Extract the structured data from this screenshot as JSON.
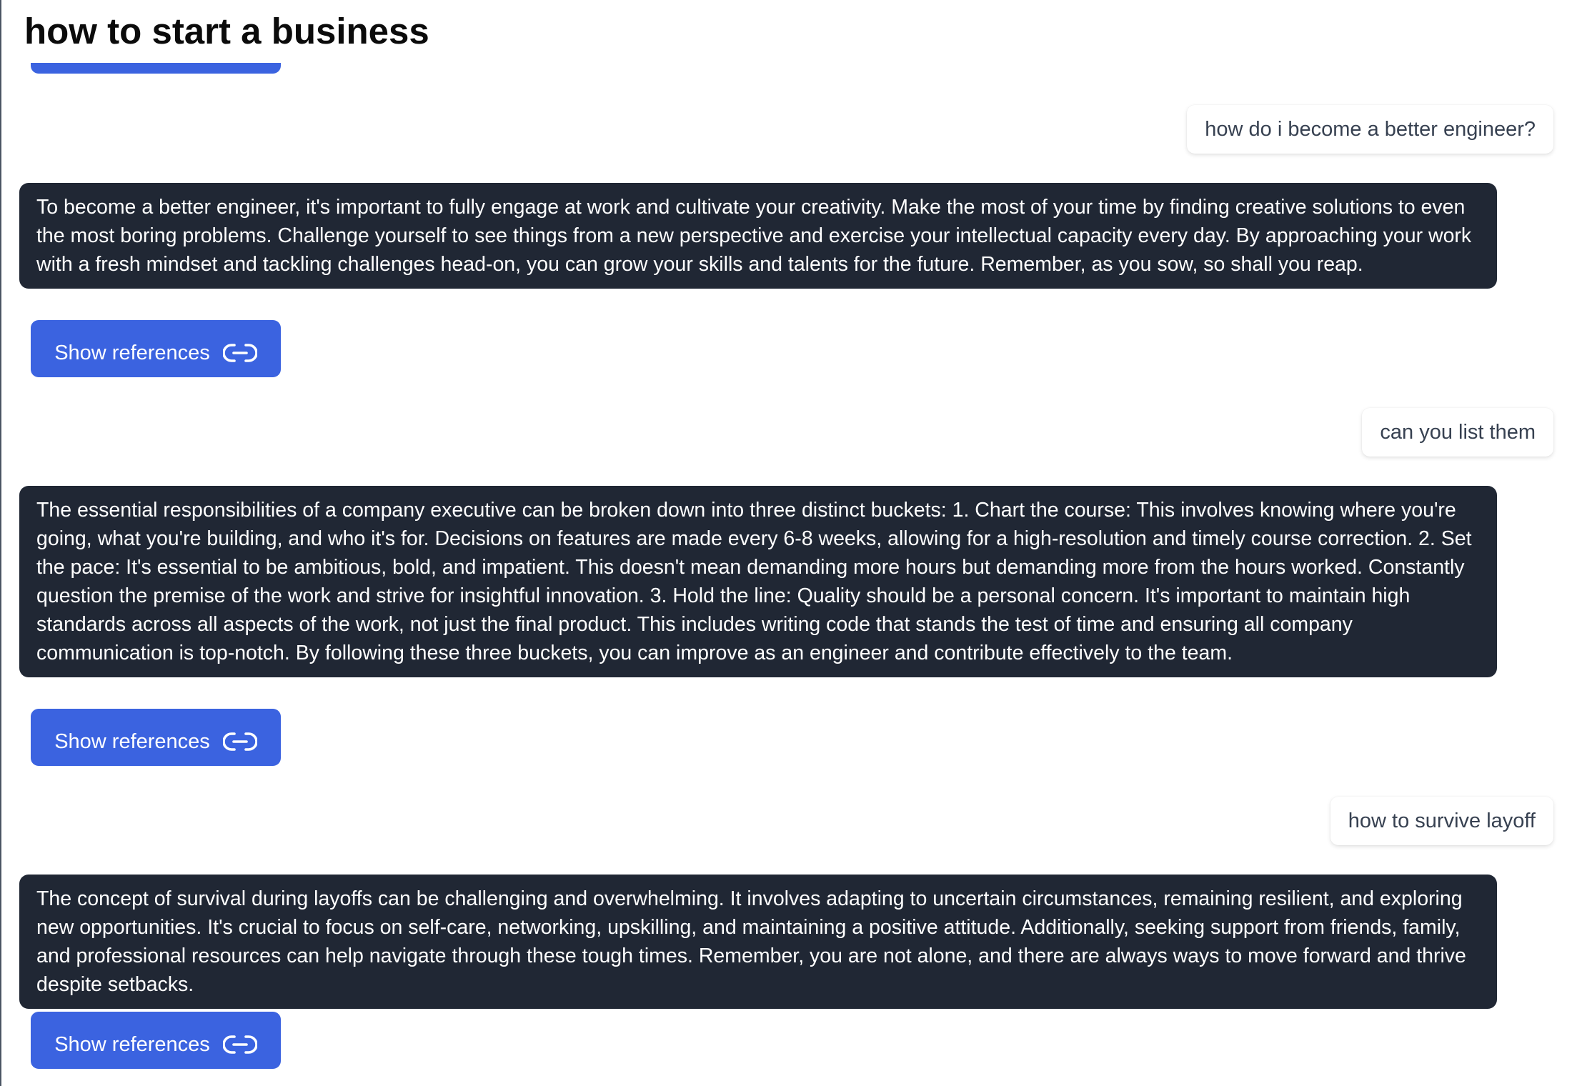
{
  "page": {
    "title": "how to start a business"
  },
  "conversation": [
    {
      "role": "user",
      "text": "how do i become a better engineer?"
    },
    {
      "role": "assistant",
      "text": "To become a better engineer, it's important to fully engage at work and cultivate your creativity. Make the most of your time by finding creative solutions to even the most boring problems. Challenge yourself to see things from a new perspective and exercise your intellectual capacity every day. By approaching your work with a fresh mindset and tackling challenges head-on, you can grow your skills and talents for the future. Remember, as you sow, so shall you reap.",
      "references_label": "Show references"
    },
    {
      "role": "user",
      "text": "can you list them"
    },
    {
      "role": "assistant",
      "text": "The essential responsibilities of a company executive can be broken down into three distinct buckets: 1. Chart the course: This involves knowing where you're going, what you're building, and who it's for. Decisions on features are made every 6-8 weeks, allowing for a high-resolution and timely course correction. 2. Set the pace: It's essential to be ambitious, bold, and impatient. This doesn't mean demanding more hours but demanding more from the hours worked. Constantly question the premise of the work and strive for insightful innovation. 3. Hold the line: Quality should be a personal concern. It's important to maintain high standards across all aspects of the work, not just the final product. This includes writing code that stands the test of time and ensuring all company communication is top-notch. By following these three buckets, you can improve as an engineer and contribute effectively to the team.",
      "references_label": "Show references"
    },
    {
      "role": "user",
      "text": "how to survive layoff"
    },
    {
      "role": "assistant",
      "text": "The concept of survival during layoffs can be challenging and overwhelming. It involves adapting to uncertain circumstances, remaining resilient, and exploring new opportunities. It's crucial to focus on self-care, networking, upskilling, and maintaining a positive attitude. Additionally, seeking support from friends, family, and professional resources can help navigate through these tough times. Remember, you are not alone, and there are always ways to move forward and thrive despite setbacks.",
      "references_label": "Show references"
    }
  ],
  "icons": {
    "references": "link-icon"
  },
  "colors": {
    "accent": "#3b63e0",
    "assistant_bubble": "#202734",
    "user_text": "#374151"
  }
}
